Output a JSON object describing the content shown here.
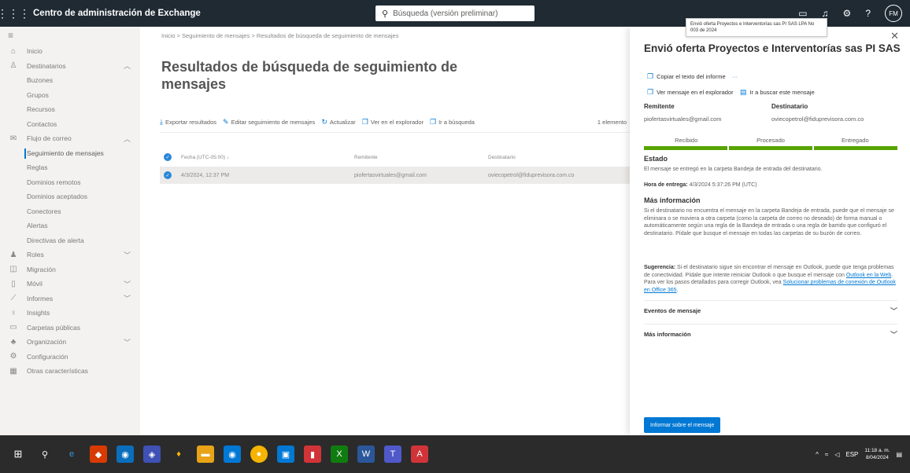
{
  "topbar": {
    "title": "Centro de administración de Exchange",
    "search_placeholder": "Búsqueda (versión preliminar)",
    "avatar": "FM"
  },
  "nav": [
    {
      "label": "Inicio",
      "icon": "home-icon",
      "level": 0
    },
    {
      "label": "Destinatarios",
      "icon": "person-icon",
      "level": 0,
      "expand": "up"
    },
    {
      "label": "Buzones",
      "level": 1
    },
    {
      "label": "Grupos",
      "level": 1
    },
    {
      "label": "Recursos",
      "level": 1
    },
    {
      "label": "Contactos",
      "level": 1
    },
    {
      "label": "Flujo de correo",
      "icon": "mail-icon",
      "level": 0,
      "expand": "up"
    },
    {
      "label": "Seguimiento de mensajes",
      "level": 1,
      "active": true
    },
    {
      "label": "Reglas",
      "level": 1
    },
    {
      "label": "Dominios remotos",
      "level": 1
    },
    {
      "label": "Dominios aceptados",
      "level": 1
    },
    {
      "label": "Conectores",
      "level": 1
    },
    {
      "label": "Alertas",
      "level": 1
    },
    {
      "label": "Directivas de alerta",
      "level": 1
    },
    {
      "label": "Roles",
      "icon": "roles-icon",
      "level": 0,
      "expand": "down"
    },
    {
      "label": "Migración",
      "icon": "migration-icon",
      "level": 0
    },
    {
      "label": "Móvil",
      "icon": "mobile-icon",
      "level": 0,
      "expand": "down"
    },
    {
      "label": "Informes",
      "icon": "reports-icon",
      "level": 0,
      "expand": "down"
    },
    {
      "label": "Insights",
      "icon": "insights-icon",
      "level": 0
    },
    {
      "label": "Carpetas públicas",
      "icon": "folder-icon",
      "level": 0
    },
    {
      "label": "Organización",
      "icon": "org-icon",
      "level": 0,
      "expand": "down"
    },
    {
      "label": "Configuración",
      "icon": "gear-icon",
      "level": 0
    },
    {
      "label": "Otras características",
      "icon": "grid-icon",
      "level": 0
    }
  ],
  "main": {
    "breadcrumb": "Inicio  >  Seguimiento de mensajes  >  Resultados de búsqueda de seguimiento de mensajes",
    "title": "Resultados de búsqueda de seguimiento de mensajes",
    "toolbar": {
      "export": "Exportar resultados",
      "edit": "Editar seguimiento de mensajes",
      "refresh": "Actualizar",
      "explorer": "Ver en el explorador",
      "goto": "Ir a búsqueda",
      "count": "1 elemento"
    },
    "columns": {
      "date": "Fecha (UTC-05:00) ↓",
      "sender": "Remitente",
      "recipient": "Destinatario"
    },
    "rows": [
      {
        "date": "4/3/2024, 12:37 PM",
        "sender": "piofertasvirtuales@gmail.com",
        "recipient": "oviecopetrol@fiduprevisora.com.co"
      }
    ]
  },
  "panel": {
    "tooltip": "Envió oferta Proyectos e Interventorías sas PI SAS LPA No 003 de 2024",
    "title": "Envió oferta Proyectos e Interventorías sas PI SAS LPA...",
    "copy_report": "Copiar el texto del informe",
    "more": "···",
    "view_explorer": "Ver mensaje en el explorador",
    "find_message": "Ir a buscar este mensaje",
    "sender_label": "Remitente",
    "sender_value": "piofertasvirtuales@gmail.com",
    "recipient_label": "Destinatario",
    "recipient_value": "oviecopetrol@fiduprevisora.com.co",
    "progress": [
      "Recibido",
      "Procesado",
      "Entregado"
    ],
    "status_heading": "Estado",
    "status_text": "El mensaje se entregó en la carpeta Bandeja de entrada del destinatario.",
    "delivery_label": "Hora de entrega:",
    "delivery_value": "4/3/2024 5:37:26 PM (UTC)",
    "more_info_heading": "Más información",
    "more_info_text": "Si el destinatario no encuentra el mensaje en la carpeta Bandeja de entrada, puede que el mensaje se eliminara o se moviera a otra carpeta (como la carpeta de correo no deseado) de forma manual o automáticamente según una regla de la Bandeja de entrada o una regla de barrido que configuró el destinatario. Pídale que busque el mensaje en todas las carpetas de su buzón de correo.",
    "tip_label": "Sugerencia:",
    "tip_text_1": "Si el destinatario sigue sin encontrar el mensaje en Outlook, puede que tenga problemas de conectividad. Pídale que intente reiniciar Outlook o que busque el mensaje con",
    "tip_link_1": "Outlook en la Web",
    "tip_text_2": ". Para ver los pasos detallados para corregir Outlook, vea",
    "tip_link_2": "Solucionar problemas de conexión de Outlook en Office 365",
    "tip_text_3": ".",
    "accordion_events": "Eventos de mensaje",
    "accordion_more": "Más información",
    "report_button": "Informar sobre el mensaje",
    "accent": "#0078d4",
    "progress_color": "#57a300"
  },
  "taskbar": {
    "lang": "ESP",
    "time": "11:18 a. m.",
    "date": "8/04/2024"
  }
}
